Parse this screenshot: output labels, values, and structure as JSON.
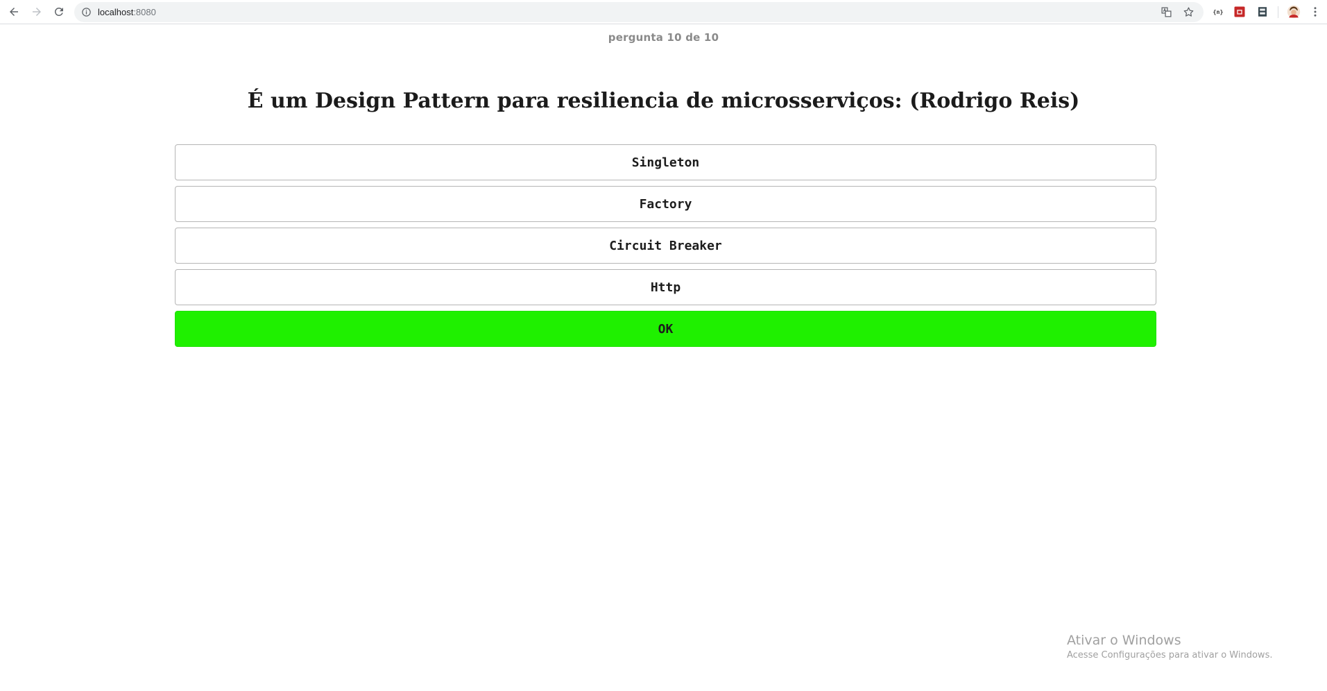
{
  "browser": {
    "url_host": "localhost",
    "url_port": ":8080",
    "icons": {
      "back": "back-arrow-icon",
      "forward": "forward-arrow-icon",
      "reload": "reload-icon",
      "info": "info-icon",
      "translate": "translate-icon",
      "bookmark": "star-icon",
      "menu": "kebab-menu-icon"
    }
  },
  "quiz": {
    "counter": "pergunta 10 de 10",
    "question": "É um Design Pattern para resiliencia de microsserviços: (Rodrigo Reis)",
    "options": [
      {
        "label": "Singleton"
      },
      {
        "label": "Factory"
      },
      {
        "label": "Circuit Breaker"
      },
      {
        "label": "Http"
      }
    ],
    "ok_label": "OK",
    "ok_color": "#1ff000"
  },
  "watermark": {
    "title": "Ativar o Windows",
    "subtitle": "Acesse Configurações para ativar o Windows."
  }
}
